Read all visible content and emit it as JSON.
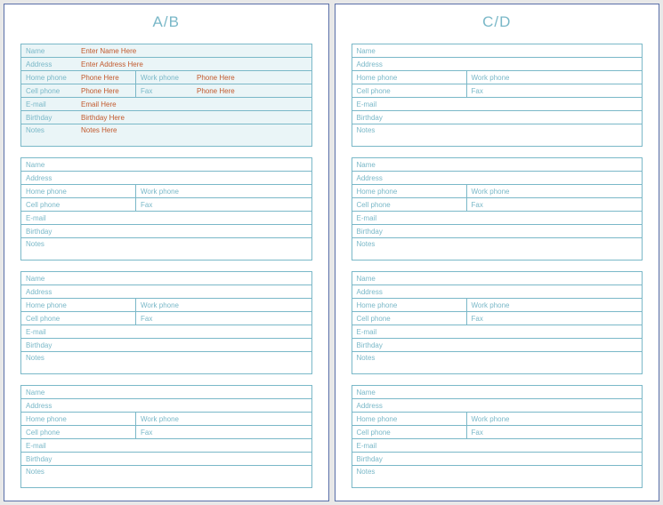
{
  "leftTitle": "A/B",
  "rightTitle": "C/D",
  "labels": {
    "name": "Name",
    "address": "Address",
    "homePhone": "Home phone",
    "workPhone": "Work phone",
    "cellPhone": "Cell phone",
    "fax": "Fax",
    "email": "E-mail",
    "birthday": "Birthday",
    "notes": "Notes"
  },
  "sample": {
    "name": "Enter Name Here",
    "address": "Enter Address Here",
    "homePhone": "Phone Here",
    "workPhone": "Phone Here",
    "cellPhone": "Phone Here",
    "fax": "Phone Here",
    "email": "Email Here",
    "birthday": "Birthday Here",
    "notes": "Notes Here"
  }
}
